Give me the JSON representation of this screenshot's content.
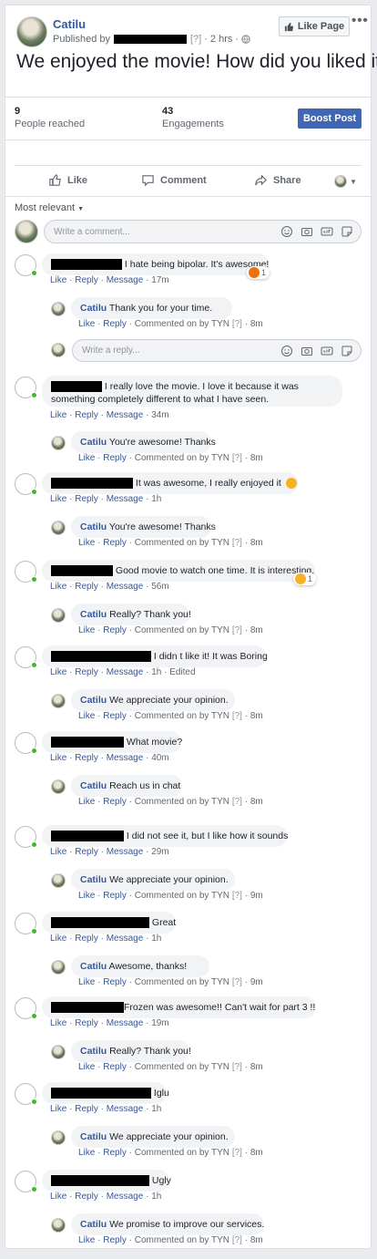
{
  "post": {
    "page_name": "Catilu",
    "published_by": "Published by",
    "publisher_tag": "[?]",
    "time": "2 hrs",
    "like_page": "Like Page",
    "text": "We enjoyed the movie! How did you liked it?"
  },
  "stats": {
    "reached_count": "9",
    "reached_label": "People reached",
    "engagements_count": "43",
    "engagements_label": "Engagements",
    "boost": "Boost Post"
  },
  "actions": {
    "like": "Like",
    "comment": "Comment",
    "share": "Share"
  },
  "sort": "Most relevant",
  "composer": {
    "comment_placeholder": "Write a comment...",
    "reply_placeholder": "Write a reply..."
  },
  "labels": {
    "like": "Like",
    "reply": "Reply",
    "message": "Message",
    "commented_on_by": "Commented on by TYN",
    "tag": "[?]"
  },
  "comments": [
    {
      "text": " I hate being bipolar. It's awesome!",
      "time": "17m",
      "reaction": {
        "emoji": "angry",
        "count": "1"
      },
      "reply": {
        "author": "Catilu",
        "text": "Thank you for your time.",
        "time": "8m"
      }
    },
    {
      "text": " I really love the movie. I love it because it was",
      "text2": "something completely different to what I have seen.",
      "time": "34m",
      "reply": {
        "author": "Catilu",
        "text": "You're awesome! Thanks",
        "time": "8m"
      }
    },
    {
      "text": " It was awesome, I really enjoyed it ",
      "emoji": "smile",
      "time": "1h",
      "reply": {
        "author": "Catilu",
        "text": "You're awesome! Thanks",
        "time": "8m"
      }
    },
    {
      "text": " Good movie to watch one time. It is interesting.",
      "time": "56m",
      "reaction": {
        "emoji": "sad",
        "count": "1"
      },
      "reply": {
        "author": "Catilu",
        "text": "Really? Thank you!",
        "time": "8m"
      }
    },
    {
      "text": " I didn t like it! It was Boring",
      "time": "1h",
      "edited": "Edited",
      "reply": {
        "author": "Catilu",
        "text": "We appreciate your opinion.",
        "time": "8m"
      }
    },
    {
      "text": " What movie?",
      "time": "40m",
      "reply": {
        "author": "Catilu",
        "text": "Reach us in chat",
        "time": "8m"
      }
    },
    {
      "text": " I did not see it, but I like how it sounds",
      "time": "29m",
      "reply": {
        "author": "Catilu",
        "text": "We appreciate your opinion.",
        "time": "9m"
      }
    },
    {
      "text": " Great",
      "time": "1h",
      "reply": {
        "author": "Catilu",
        "text": "Awesome, thanks!",
        "time": "9m"
      }
    },
    {
      "text": "Frozen was awesome!! Can't wait for part 3 !!",
      "time": "19m",
      "reply": {
        "author": "Catilu",
        "text": "Really? Thank you!",
        "time": "8m"
      }
    },
    {
      "text": " Iglu",
      "time": "1h",
      "reply": {
        "author": "Catilu",
        "text": "We appreciate your opinion.",
        "time": "8m"
      }
    },
    {
      "text": " Ugly",
      "time": "1h",
      "reply": {
        "author": "Catilu",
        "text": "We promise to improve our services.",
        "time": "8m"
      }
    }
  ]
}
